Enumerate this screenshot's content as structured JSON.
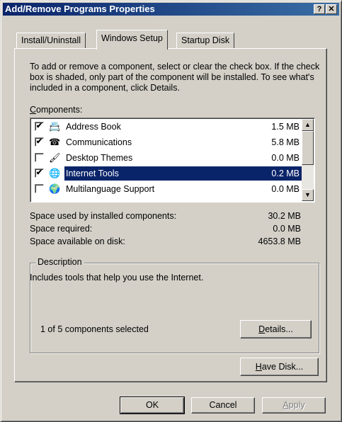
{
  "window": {
    "title": "Add/Remove Programs Properties",
    "help_label": "?",
    "close_label": "✕"
  },
  "tabs": [
    {
      "label": "Install/Uninstall"
    },
    {
      "label": "Windows Setup"
    },
    {
      "label": "Startup Disk"
    }
  ],
  "intro_text": "To add or remove a component, select or clear the check box. If the check box is shaded, only part of the component will be installed. To see what's included in a component, click Details.",
  "components_label_first": "C",
  "components_label_rest": "omponents:",
  "components": [
    {
      "name": "Address Book",
      "size": "1.5 MB",
      "checked": true,
      "icon": "address-book-icon",
      "glyph": "📇"
    },
    {
      "name": "Communications",
      "size": "5.8 MB",
      "checked": true,
      "icon": "communications-icon",
      "glyph": "☎"
    },
    {
      "name": "Desktop Themes",
      "size": "0.0 MB",
      "checked": false,
      "icon": "desktop-themes-icon",
      "glyph": "🖌"
    },
    {
      "name": "Internet Tools",
      "size": "0.2 MB",
      "checked": true,
      "icon": "internet-tools-icon",
      "glyph": "🌐"
    },
    {
      "name": "Multilanguage Support",
      "size": "0.0 MB",
      "checked": false,
      "icon": "multilanguage-icon",
      "glyph": "🌍"
    }
  ],
  "stats": {
    "used_label": "Space used by installed components:",
    "used_value": "30.2 MB",
    "required_label": "Space required:",
    "required_value": "0.0 MB",
    "available_label": "Space available on disk:",
    "available_value": "4653.8 MB"
  },
  "description": {
    "title": "Description",
    "text": "Includes tools that help you use the Internet.",
    "selected_count": "1 of 5 components selected"
  },
  "buttons": {
    "details_first": "D",
    "details_rest": "etails...",
    "have_disk_first": "H",
    "have_disk_rest": "ave Disk...",
    "ok": "OK",
    "cancel": "Cancel",
    "apply_first": "A",
    "apply_rest": "pply"
  }
}
